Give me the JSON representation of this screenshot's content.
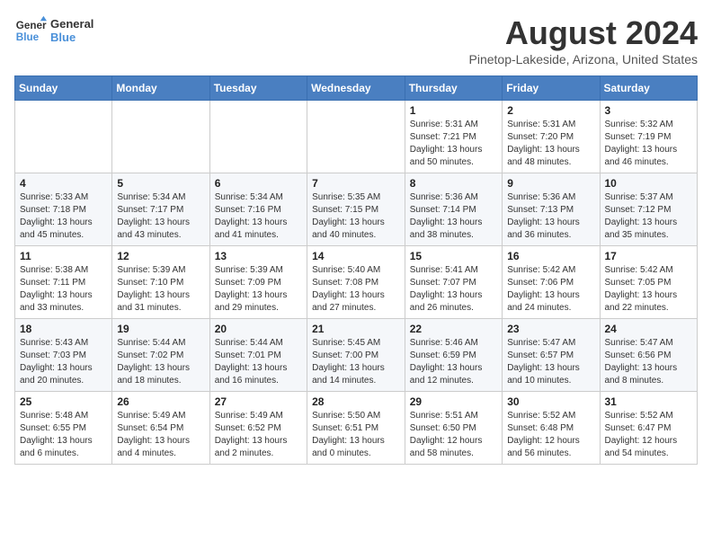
{
  "logo": {
    "line1": "General",
    "line2": "Blue"
  },
  "title": "August 2024",
  "subtitle": "Pinetop-Lakeside, Arizona, United States",
  "days_of_week": [
    "Sunday",
    "Monday",
    "Tuesday",
    "Wednesday",
    "Thursday",
    "Friday",
    "Saturday"
  ],
  "weeks": [
    [
      {
        "day": "",
        "info": ""
      },
      {
        "day": "",
        "info": ""
      },
      {
        "day": "",
        "info": ""
      },
      {
        "day": "",
        "info": ""
      },
      {
        "day": "1",
        "info": "Sunrise: 5:31 AM\nSunset: 7:21 PM\nDaylight: 13 hours\nand 50 minutes."
      },
      {
        "day": "2",
        "info": "Sunrise: 5:31 AM\nSunset: 7:20 PM\nDaylight: 13 hours\nand 48 minutes."
      },
      {
        "day": "3",
        "info": "Sunrise: 5:32 AM\nSunset: 7:19 PM\nDaylight: 13 hours\nand 46 minutes."
      }
    ],
    [
      {
        "day": "4",
        "info": "Sunrise: 5:33 AM\nSunset: 7:18 PM\nDaylight: 13 hours\nand 45 minutes."
      },
      {
        "day": "5",
        "info": "Sunrise: 5:34 AM\nSunset: 7:17 PM\nDaylight: 13 hours\nand 43 minutes."
      },
      {
        "day": "6",
        "info": "Sunrise: 5:34 AM\nSunset: 7:16 PM\nDaylight: 13 hours\nand 41 minutes."
      },
      {
        "day": "7",
        "info": "Sunrise: 5:35 AM\nSunset: 7:15 PM\nDaylight: 13 hours\nand 40 minutes."
      },
      {
        "day": "8",
        "info": "Sunrise: 5:36 AM\nSunset: 7:14 PM\nDaylight: 13 hours\nand 38 minutes."
      },
      {
        "day": "9",
        "info": "Sunrise: 5:36 AM\nSunset: 7:13 PM\nDaylight: 13 hours\nand 36 minutes."
      },
      {
        "day": "10",
        "info": "Sunrise: 5:37 AM\nSunset: 7:12 PM\nDaylight: 13 hours\nand 35 minutes."
      }
    ],
    [
      {
        "day": "11",
        "info": "Sunrise: 5:38 AM\nSunset: 7:11 PM\nDaylight: 13 hours\nand 33 minutes."
      },
      {
        "day": "12",
        "info": "Sunrise: 5:39 AM\nSunset: 7:10 PM\nDaylight: 13 hours\nand 31 minutes."
      },
      {
        "day": "13",
        "info": "Sunrise: 5:39 AM\nSunset: 7:09 PM\nDaylight: 13 hours\nand 29 minutes."
      },
      {
        "day": "14",
        "info": "Sunrise: 5:40 AM\nSunset: 7:08 PM\nDaylight: 13 hours\nand 27 minutes."
      },
      {
        "day": "15",
        "info": "Sunrise: 5:41 AM\nSunset: 7:07 PM\nDaylight: 13 hours\nand 26 minutes."
      },
      {
        "day": "16",
        "info": "Sunrise: 5:42 AM\nSunset: 7:06 PM\nDaylight: 13 hours\nand 24 minutes."
      },
      {
        "day": "17",
        "info": "Sunrise: 5:42 AM\nSunset: 7:05 PM\nDaylight: 13 hours\nand 22 minutes."
      }
    ],
    [
      {
        "day": "18",
        "info": "Sunrise: 5:43 AM\nSunset: 7:03 PM\nDaylight: 13 hours\nand 20 minutes."
      },
      {
        "day": "19",
        "info": "Sunrise: 5:44 AM\nSunset: 7:02 PM\nDaylight: 13 hours\nand 18 minutes."
      },
      {
        "day": "20",
        "info": "Sunrise: 5:44 AM\nSunset: 7:01 PM\nDaylight: 13 hours\nand 16 minutes."
      },
      {
        "day": "21",
        "info": "Sunrise: 5:45 AM\nSunset: 7:00 PM\nDaylight: 13 hours\nand 14 minutes."
      },
      {
        "day": "22",
        "info": "Sunrise: 5:46 AM\nSunset: 6:59 PM\nDaylight: 13 hours\nand 12 minutes."
      },
      {
        "day": "23",
        "info": "Sunrise: 5:47 AM\nSunset: 6:57 PM\nDaylight: 13 hours\nand 10 minutes."
      },
      {
        "day": "24",
        "info": "Sunrise: 5:47 AM\nSunset: 6:56 PM\nDaylight: 13 hours\nand 8 minutes."
      }
    ],
    [
      {
        "day": "25",
        "info": "Sunrise: 5:48 AM\nSunset: 6:55 PM\nDaylight: 13 hours\nand 6 minutes."
      },
      {
        "day": "26",
        "info": "Sunrise: 5:49 AM\nSunset: 6:54 PM\nDaylight: 13 hours\nand 4 minutes."
      },
      {
        "day": "27",
        "info": "Sunrise: 5:49 AM\nSunset: 6:52 PM\nDaylight: 13 hours\nand 2 minutes."
      },
      {
        "day": "28",
        "info": "Sunrise: 5:50 AM\nSunset: 6:51 PM\nDaylight: 13 hours\nand 0 minutes."
      },
      {
        "day": "29",
        "info": "Sunrise: 5:51 AM\nSunset: 6:50 PM\nDaylight: 12 hours\nand 58 minutes."
      },
      {
        "day": "30",
        "info": "Sunrise: 5:52 AM\nSunset: 6:48 PM\nDaylight: 12 hours\nand 56 minutes."
      },
      {
        "day": "31",
        "info": "Sunrise: 5:52 AM\nSunset: 6:47 PM\nDaylight: 12 hours\nand 54 minutes."
      }
    ]
  ]
}
